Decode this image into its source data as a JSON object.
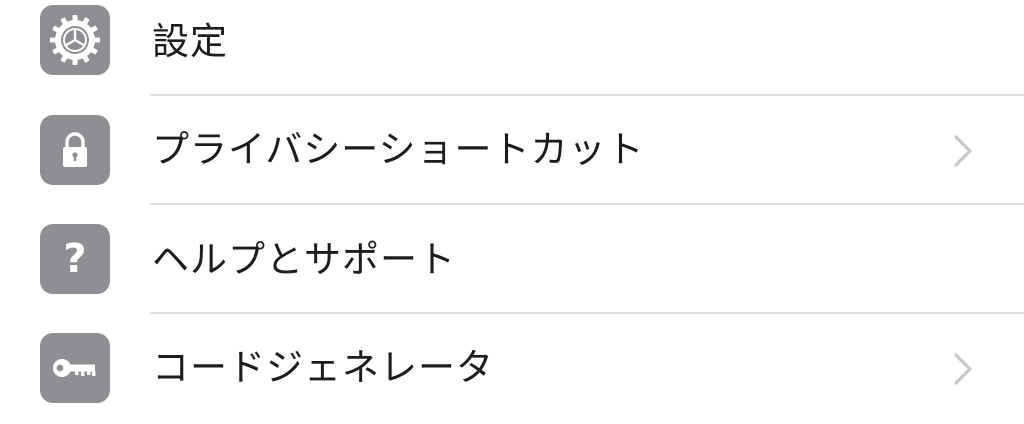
{
  "menu": {
    "items": [
      {
        "label": "設定",
        "icon": "gear-icon",
        "has_chevron": false
      },
      {
        "label": "プライバシーショートカット",
        "icon": "lock-icon",
        "has_chevron": true
      },
      {
        "label": "ヘルプとサポート",
        "icon": "question-mark-icon",
        "icon_text": "?",
        "has_chevron": false
      },
      {
        "label": "コードジェネレータ",
        "icon": "key-icon",
        "has_chevron": true
      }
    ]
  },
  "colors": {
    "icon_background": "#8e8e93",
    "label_text": "#1c1c1e",
    "divider": "#dcdcde",
    "chevron": "#c7c7cc",
    "background": "#ffffff"
  }
}
